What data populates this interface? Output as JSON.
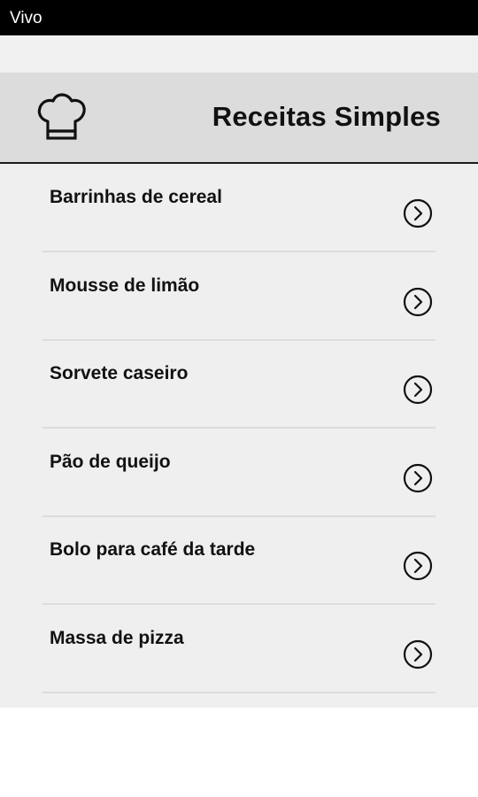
{
  "status_bar": {
    "carrier": "Vivo"
  },
  "header": {
    "icon": "chef-hat-icon",
    "title": "Receitas Simples"
  },
  "recipes": [
    {
      "label": "Barrinhas de cereal"
    },
    {
      "label": "Mousse de limão"
    },
    {
      "label": "Sorvete caseiro"
    },
    {
      "label": "Pão de queijo"
    },
    {
      "label": "Bolo para café da tarde"
    },
    {
      "label": "Massa de pizza"
    }
  ],
  "icons": {
    "list_item_action": "chevron-right-circle-icon"
  }
}
